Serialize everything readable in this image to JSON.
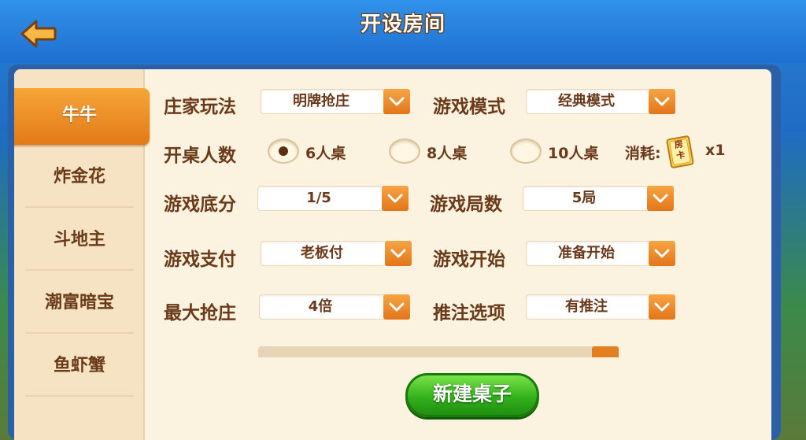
{
  "header": {
    "title": "开设房间"
  },
  "sidebar": {
    "items": [
      {
        "label": "牛牛"
      },
      {
        "label": "炸金花"
      },
      {
        "label": "斗地主"
      },
      {
        "label": "潮富暗宝"
      },
      {
        "label": "鱼虾蟹"
      },
      {
        "label": ""
      }
    ]
  },
  "form": {
    "banker_mode": {
      "label": "庄家玩法",
      "value": "明牌抢庄"
    },
    "game_mode": {
      "label": "游戏模式",
      "value": "经典模式"
    },
    "table_size": {
      "label": "开桌人数",
      "options": [
        "6人桌",
        "8人桌",
        "10人桌"
      ],
      "selected": "6人桌"
    },
    "cost": {
      "label": "消耗:",
      "card_text": "房卡",
      "amount": "x1"
    },
    "base_score": {
      "label": "游戏底分",
      "value": "1/5"
    },
    "rounds": {
      "label": "游戏局数",
      "value": "5局"
    },
    "payment": {
      "label": "游戏支付",
      "value": "老板付"
    },
    "start": {
      "label": "游戏开始",
      "value": "准备开始"
    },
    "max_bank": {
      "label": "最大抢庄",
      "value": "4倍"
    },
    "push_bet": {
      "label": "推注选项",
      "value": "有推注"
    }
  },
  "actions": {
    "create_label": "新建桌子"
  },
  "colors": {
    "accent_orange": "#e27a17",
    "text_brown": "#6b3a1a",
    "panel_bg": "#fbf3df",
    "create_green": "#33b21c",
    "header_blue": "#1f6fcf"
  },
  "icons": [
    "back-arrow-icon",
    "chevron-down-icon",
    "room-card-icon"
  ]
}
